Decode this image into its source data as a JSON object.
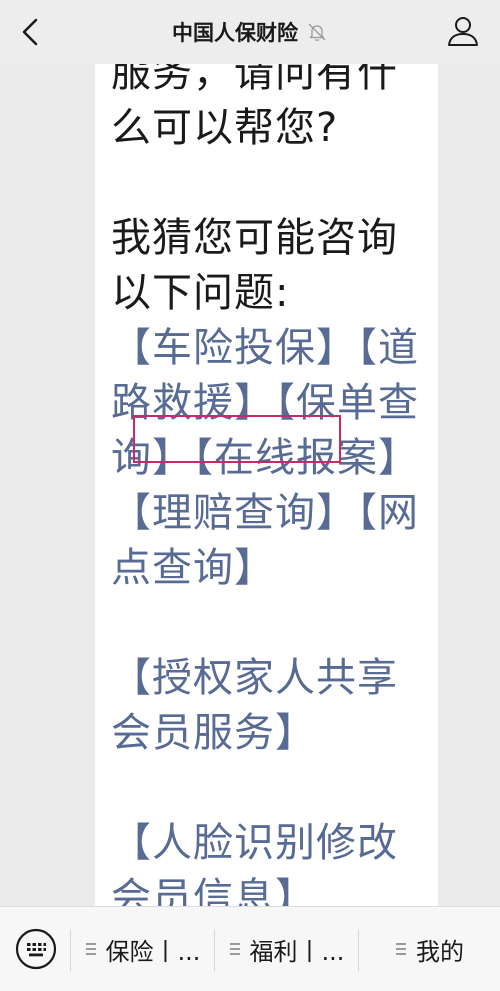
{
  "header": {
    "title": "中国人保财险"
  },
  "chat": {
    "top_fragment": "服务，请问有什么可以帮您?",
    "guess_prompt": "我猜您可能咨询以下问题:",
    "quick_links": [
      {
        "label": "【车险投保】"
      },
      {
        "label": "【道路救援】"
      },
      {
        "label": "【保单查询】"
      },
      {
        "label": "【在线报案】"
      },
      {
        "label": "【理赔查询】"
      },
      {
        "label": "【网点查询】"
      }
    ],
    "link_family": "【授权家人共享会员服务】",
    "link_face": "【人脸识别修改会员信息】"
  },
  "menu": {
    "tabs": [
      {
        "label": "保险丨..."
      },
      {
        "label": "福利丨..."
      },
      {
        "label": "我的"
      }
    ]
  },
  "colors": {
    "link": "#576b95",
    "highlight": "#c72a6a"
  }
}
